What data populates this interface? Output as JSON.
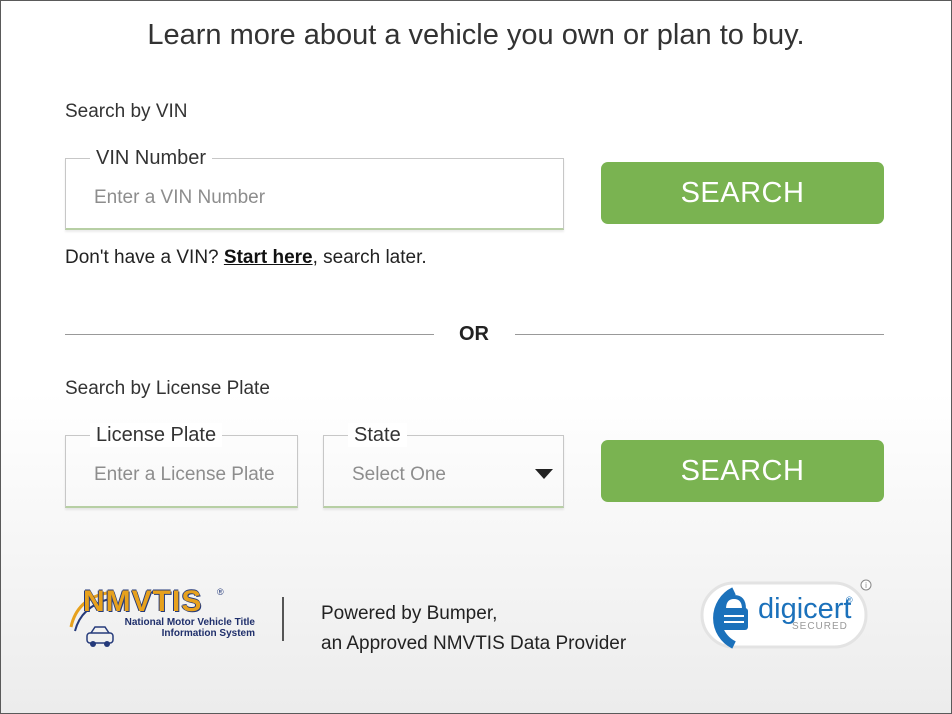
{
  "headline": "Learn more about a vehicle you own or plan to buy.",
  "vin_section": {
    "label": "Search by VIN",
    "field_legend": "VIN Number",
    "placeholder": "Enter a VIN Number",
    "button_label": "SEARCH",
    "help_prefix": "Don't have a VIN? ",
    "help_link": "Start here",
    "help_suffix": ", search later."
  },
  "divider_text": "OR",
  "plate_section": {
    "label": "Search by License Plate",
    "plate_legend": "License Plate",
    "plate_placeholder": "Enter a License Plate",
    "state_legend": "State",
    "state_selected": "Select One",
    "button_label": "SEARCH"
  },
  "footer": {
    "nmvtis_logo_text": "NMVTIS",
    "nmvtis_registered": "®",
    "nmvtis_subtitle_1": "National Motor Vehicle Title",
    "nmvtis_subtitle_2": "Information System",
    "powered_line_1": "Powered by Bumper,",
    "powered_line_2": "an Approved NMVTIS Data Provider",
    "digicert_text": "digicert",
    "digicert_registered": "®",
    "digicert_secured": "SECURED",
    "info_icon": "info-icon"
  },
  "colors": {
    "button_green": "#7ab351",
    "nmvtis_gold": "#e7a11d",
    "nmvtis_navy": "#253a7a",
    "digicert_blue": "#1b71bb"
  }
}
